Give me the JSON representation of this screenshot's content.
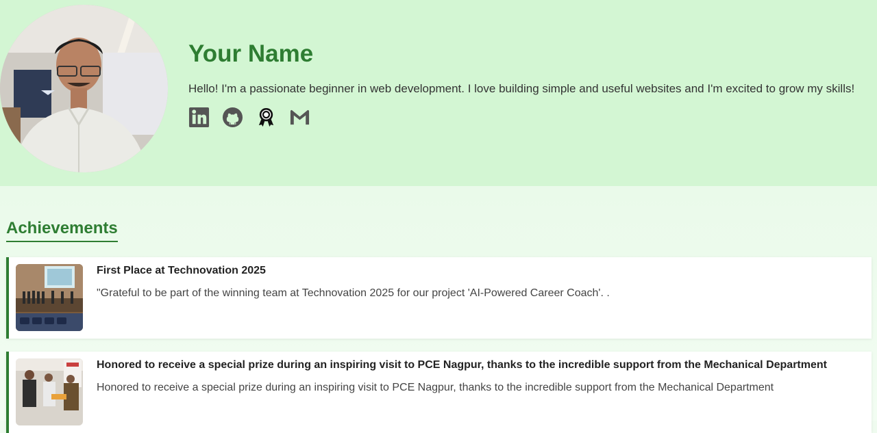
{
  "profile": {
    "name": "Your Name",
    "bio": "Hello! I'm a passionate beginner in web development. I love building simple and useful websites and I'm excited to grow my skills!",
    "photo_alt": "profile-photo"
  },
  "socials": [
    {
      "icon": "linkedin-icon"
    },
    {
      "icon": "github-icon"
    },
    {
      "icon": "certificate-badge-icon"
    },
    {
      "icon": "gmail-icon"
    }
  ],
  "achievements": {
    "heading": "Achievements",
    "items": [
      {
        "title": "First Place at Technovation 2025",
        "description": "\"Grateful to be part of the winning team at Technovation 2025 for our project 'AI-Powered Career Coach'. ."
      },
      {
        "title": "Honored to receive a special prize during an inspiring visit to PCE Nagpur, thanks to the incredible support from the Mechanical Department",
        "description": "Honored to receive a special prize during an inspiring visit to PCE Nagpur, thanks to the incredible support from the Mechanical Department"
      }
    ]
  },
  "colors": {
    "accent": "#2e7d32",
    "hero_bg": "#d3f6d3",
    "page_bg": "#effbef",
    "icon": "#555555"
  }
}
